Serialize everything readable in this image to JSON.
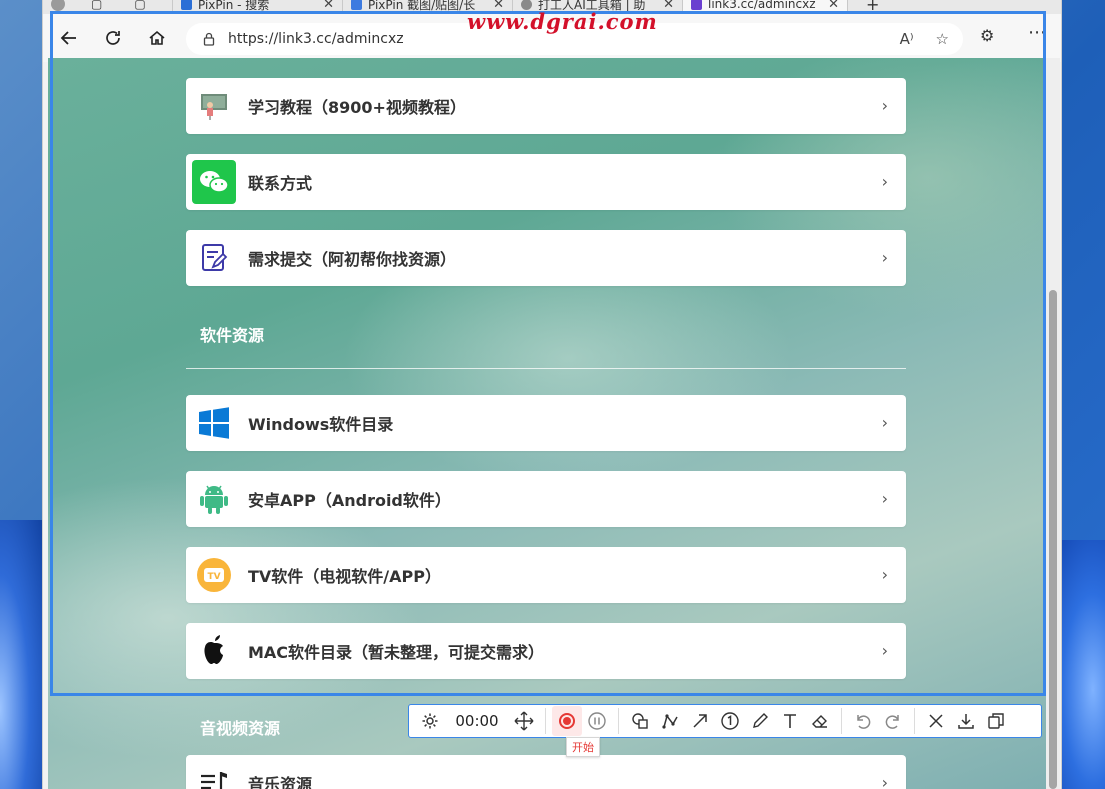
{
  "browser": {
    "tabs": [
      {
        "label": "PixPin - 搜索"
      },
      {
        "label": "PixPin 截图/贴图/长"
      },
      {
        "label": "打工人AI工具箱 | 助"
      },
      {
        "label": "link3.cc/admincxz"
      }
    ],
    "new_tab": "+",
    "address": "https://link3.cc/admincxz",
    "watermark": "www.dgrai.com"
  },
  "page": {
    "top_items": [
      {
        "label": "学习教程（8900+视频教程）",
        "icon": "teacher-icon"
      },
      {
        "label": "联系方式",
        "icon": "wechat-icon"
      },
      {
        "label": "需求提交（阿初帮你找资源）",
        "icon": "form-icon"
      }
    ],
    "software_section": "软件资源",
    "software_items": [
      {
        "label": "Windows软件目录",
        "icon": "windows-icon"
      },
      {
        "label": "安卓APP（Android软件）",
        "icon": "android-icon"
      },
      {
        "label": "TV软件（电视软件/APP）",
        "icon": "tv-icon"
      },
      {
        "label": "MAC软件目录（暂未整理，可提交需求）",
        "icon": "apple-icon"
      }
    ],
    "av_section": "音视频资源",
    "av_items": [
      {
        "label": "音乐资源",
        "icon": "music-icon"
      }
    ],
    "chevron": "›"
  },
  "recorder": {
    "time": "00:00",
    "tooltip": "开始",
    "colors": {
      "frame": "#3a86e8",
      "record": "#e53935"
    }
  }
}
